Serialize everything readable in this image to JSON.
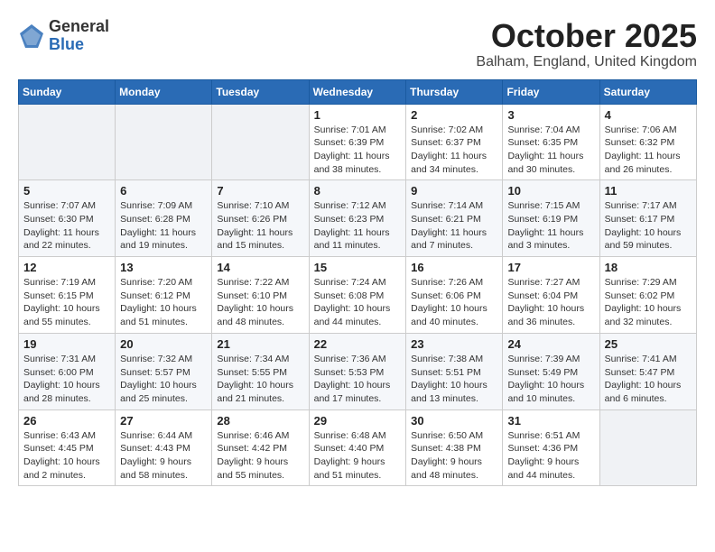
{
  "logo": {
    "general": "General",
    "blue": "Blue"
  },
  "title": "October 2025",
  "location": "Balham, England, United Kingdom",
  "days_of_week": [
    "Sunday",
    "Monday",
    "Tuesday",
    "Wednesday",
    "Thursday",
    "Friday",
    "Saturday"
  ],
  "weeks": [
    [
      {
        "day": "",
        "info": ""
      },
      {
        "day": "",
        "info": ""
      },
      {
        "day": "",
        "info": ""
      },
      {
        "day": "1",
        "info": "Sunrise: 7:01 AM\nSunset: 6:39 PM\nDaylight: 11 hours and 38 minutes."
      },
      {
        "day": "2",
        "info": "Sunrise: 7:02 AM\nSunset: 6:37 PM\nDaylight: 11 hours and 34 minutes."
      },
      {
        "day": "3",
        "info": "Sunrise: 7:04 AM\nSunset: 6:35 PM\nDaylight: 11 hours and 30 minutes."
      },
      {
        "day": "4",
        "info": "Sunrise: 7:06 AM\nSunset: 6:32 PM\nDaylight: 11 hours and 26 minutes."
      }
    ],
    [
      {
        "day": "5",
        "info": "Sunrise: 7:07 AM\nSunset: 6:30 PM\nDaylight: 11 hours and 22 minutes."
      },
      {
        "day": "6",
        "info": "Sunrise: 7:09 AM\nSunset: 6:28 PM\nDaylight: 11 hours and 19 minutes."
      },
      {
        "day": "7",
        "info": "Sunrise: 7:10 AM\nSunset: 6:26 PM\nDaylight: 11 hours and 15 minutes."
      },
      {
        "day": "8",
        "info": "Sunrise: 7:12 AM\nSunset: 6:23 PM\nDaylight: 11 hours and 11 minutes."
      },
      {
        "day": "9",
        "info": "Sunrise: 7:14 AM\nSunset: 6:21 PM\nDaylight: 11 hours and 7 minutes."
      },
      {
        "day": "10",
        "info": "Sunrise: 7:15 AM\nSunset: 6:19 PM\nDaylight: 11 hours and 3 minutes."
      },
      {
        "day": "11",
        "info": "Sunrise: 7:17 AM\nSunset: 6:17 PM\nDaylight: 10 hours and 59 minutes."
      }
    ],
    [
      {
        "day": "12",
        "info": "Sunrise: 7:19 AM\nSunset: 6:15 PM\nDaylight: 10 hours and 55 minutes."
      },
      {
        "day": "13",
        "info": "Sunrise: 7:20 AM\nSunset: 6:12 PM\nDaylight: 10 hours and 51 minutes."
      },
      {
        "day": "14",
        "info": "Sunrise: 7:22 AM\nSunset: 6:10 PM\nDaylight: 10 hours and 48 minutes."
      },
      {
        "day": "15",
        "info": "Sunrise: 7:24 AM\nSunset: 6:08 PM\nDaylight: 10 hours and 44 minutes."
      },
      {
        "day": "16",
        "info": "Sunrise: 7:26 AM\nSunset: 6:06 PM\nDaylight: 10 hours and 40 minutes."
      },
      {
        "day": "17",
        "info": "Sunrise: 7:27 AM\nSunset: 6:04 PM\nDaylight: 10 hours and 36 minutes."
      },
      {
        "day": "18",
        "info": "Sunrise: 7:29 AM\nSunset: 6:02 PM\nDaylight: 10 hours and 32 minutes."
      }
    ],
    [
      {
        "day": "19",
        "info": "Sunrise: 7:31 AM\nSunset: 6:00 PM\nDaylight: 10 hours and 28 minutes."
      },
      {
        "day": "20",
        "info": "Sunrise: 7:32 AM\nSunset: 5:57 PM\nDaylight: 10 hours and 25 minutes."
      },
      {
        "day": "21",
        "info": "Sunrise: 7:34 AM\nSunset: 5:55 PM\nDaylight: 10 hours and 21 minutes."
      },
      {
        "day": "22",
        "info": "Sunrise: 7:36 AM\nSunset: 5:53 PM\nDaylight: 10 hours and 17 minutes."
      },
      {
        "day": "23",
        "info": "Sunrise: 7:38 AM\nSunset: 5:51 PM\nDaylight: 10 hours and 13 minutes."
      },
      {
        "day": "24",
        "info": "Sunrise: 7:39 AM\nSunset: 5:49 PM\nDaylight: 10 hours and 10 minutes."
      },
      {
        "day": "25",
        "info": "Sunrise: 7:41 AM\nSunset: 5:47 PM\nDaylight: 10 hours and 6 minutes."
      }
    ],
    [
      {
        "day": "26",
        "info": "Sunrise: 6:43 AM\nSunset: 4:45 PM\nDaylight: 10 hours and 2 minutes."
      },
      {
        "day": "27",
        "info": "Sunrise: 6:44 AM\nSunset: 4:43 PM\nDaylight: 9 hours and 58 minutes."
      },
      {
        "day": "28",
        "info": "Sunrise: 6:46 AM\nSunset: 4:42 PM\nDaylight: 9 hours and 55 minutes."
      },
      {
        "day": "29",
        "info": "Sunrise: 6:48 AM\nSunset: 4:40 PM\nDaylight: 9 hours and 51 minutes."
      },
      {
        "day": "30",
        "info": "Sunrise: 6:50 AM\nSunset: 4:38 PM\nDaylight: 9 hours and 48 minutes."
      },
      {
        "day": "31",
        "info": "Sunrise: 6:51 AM\nSunset: 4:36 PM\nDaylight: 9 hours and 44 minutes."
      },
      {
        "day": "",
        "info": ""
      }
    ]
  ]
}
